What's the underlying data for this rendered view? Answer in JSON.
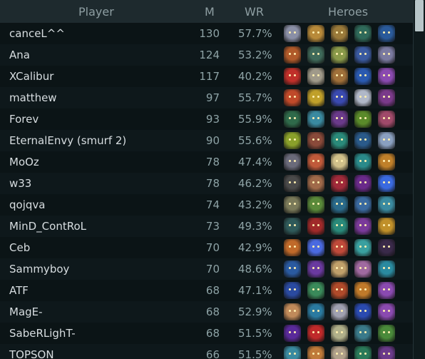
{
  "header": {
    "player": "Player",
    "m": "M",
    "wr": "WR",
    "heroes": "Heroes"
  },
  "rows": [
    {
      "name": "canceL^^",
      "m": "130",
      "wr": "57.7%",
      "heroes": [
        {
          "name": "hero-portrait",
          "color": "#8a8fa6"
        },
        {
          "name": "hero-portrait",
          "color": "#b88a3a"
        },
        {
          "name": "hero-portrait",
          "color": "#9a7a3a"
        },
        {
          "name": "hero-portrait",
          "color": "#2f6a5a"
        },
        {
          "name": "hero-portrait",
          "color": "#2a5a9a"
        }
      ]
    },
    {
      "name": "Ana",
      "m": "124",
      "wr": "53.2%",
      "heroes": [
        {
          "name": "hero-portrait",
          "color": "#b05a2a"
        },
        {
          "name": "hero-portrait",
          "color": "#3f6a5a"
        },
        {
          "name": "hero-portrait",
          "color": "#8a9a4a"
        },
        {
          "name": "hero-portrait",
          "color": "#3a5aa0"
        },
        {
          "name": "hero-portrait",
          "color": "#7a7aa0"
        }
      ]
    },
    {
      "name": "XCalibur",
      "m": "117",
      "wr": "40.2%",
      "heroes": [
        {
          "name": "hero-portrait",
          "color": "#c0302a"
        },
        {
          "name": "hero-portrait",
          "color": "#a09a8a"
        },
        {
          "name": "hero-portrait",
          "color": "#a0703a"
        },
        {
          "name": "hero-portrait",
          "color": "#2a5ab0"
        },
        {
          "name": "hero-portrait",
          "color": "#8a4ab0"
        }
      ]
    },
    {
      "name": "matthew",
      "m": "97",
      "wr": "55.7%",
      "heroes": [
        {
          "name": "hero-portrait",
          "color": "#c04a2a"
        },
        {
          "name": "hero-portrait",
          "color": "#c0a02a"
        },
        {
          "name": "hero-portrait",
          "color": "#3a4ab0"
        },
        {
          "name": "hero-portrait",
          "color": "#b0b8c8"
        },
        {
          "name": "hero-portrait",
          "color": "#7a3a8a"
        }
      ]
    },
    {
      "name": "Forev",
      "m": "93",
      "wr": "55.9%",
      "heroes": [
        {
          "name": "hero-portrait",
          "color": "#2f6a4a"
        },
        {
          "name": "hero-portrait",
          "color": "#3a8aa0"
        },
        {
          "name": "hero-portrait",
          "color": "#6a3a8a"
        },
        {
          "name": "hero-portrait",
          "color": "#5a8a2a"
        },
        {
          "name": "hero-portrait",
          "color": "#a04a6a"
        }
      ]
    },
    {
      "name": "EternalEnvy (smurf 2)",
      "m": "90",
      "wr": "55.6%",
      "heroes": [
        {
          "name": "hero-portrait",
          "color": "#8aa02a"
        },
        {
          "name": "hero-portrait",
          "color": "#8a4a3a"
        },
        {
          "name": "hero-portrait",
          "color": "#2a8a7a"
        },
        {
          "name": "hero-portrait",
          "color": "#2a5a8a"
        },
        {
          "name": "hero-portrait",
          "color": "#8aa0c0"
        }
      ]
    },
    {
      "name": "MoOz",
      "m": "78",
      "wr": "47.4%",
      "heroes": [
        {
          "name": "hero-portrait",
          "color": "#6a6a7a"
        },
        {
          "name": "hero-portrait",
          "color": "#c05a3a"
        },
        {
          "name": "hero-portrait",
          "color": "#d0c08a"
        },
        {
          "name": "hero-portrait",
          "color": "#2a8a8a"
        },
        {
          "name": "hero-portrait",
          "color": "#c0802a"
        }
      ]
    },
    {
      "name": "w33",
      "m": "78",
      "wr": "46.2%",
      "heroes": [
        {
          "name": "hero-portrait",
          "color": "#4a4a4a"
        },
        {
          "name": "hero-portrait",
          "color": "#a06a4a"
        },
        {
          "name": "hero-portrait",
          "color": "#a02a3a"
        },
        {
          "name": "hero-portrait",
          "color": "#6a2a8a"
        },
        {
          "name": "hero-portrait",
          "color": "#3a6ae0"
        }
      ]
    },
    {
      "name": "qojqva",
      "m": "74",
      "wr": "43.2%",
      "heroes": [
        {
          "name": "hero-portrait",
          "color": "#7a7a5a"
        },
        {
          "name": "hero-portrait",
          "color": "#5a8a3a"
        },
        {
          "name": "hero-portrait",
          "color": "#2a6a8a"
        },
        {
          "name": "hero-portrait",
          "color": "#3a6aa0"
        },
        {
          "name": "hero-portrait",
          "color": "#3a8aa0"
        }
      ]
    },
    {
      "name": "MinD_ContRoL",
      "m": "73",
      "wr": "49.3%",
      "heroes": [
        {
          "name": "hero-portrait",
          "color": "#2f5a5a"
        },
        {
          "name": "hero-portrait",
          "color": "#a02a2a"
        },
        {
          "name": "hero-portrait",
          "color": "#2a8a7a"
        },
        {
          "name": "hero-portrait",
          "color": "#7a3a9a"
        },
        {
          "name": "hero-portrait",
          "color": "#c0902a"
        }
      ]
    },
    {
      "name": "Ceb",
      "m": "70",
      "wr": "42.9%",
      "heroes": [
        {
          "name": "hero-portrait",
          "color": "#c06a2a"
        },
        {
          "name": "hero-portrait",
          "color": "#4a6ae0"
        },
        {
          "name": "hero-portrait",
          "color": "#c04a3a"
        },
        {
          "name": "hero-portrait",
          "color": "#3aa0a0"
        },
        {
          "name": "hero-portrait",
          "color": "#3a2a4a"
        }
      ]
    },
    {
      "name": "Sammyboy",
      "m": "70",
      "wr": "48.6%",
      "heroes": [
        {
          "name": "hero-portrait",
          "color": "#2a5aa0"
        },
        {
          "name": "hero-portrait",
          "color": "#6a3aa0"
        },
        {
          "name": "hero-portrait",
          "color": "#c0a06a"
        },
        {
          "name": "hero-portrait",
          "color": "#a06aa0"
        },
        {
          "name": "hero-portrait",
          "color": "#2a8aa0"
        }
      ]
    },
    {
      "name": "ATF",
      "m": "68",
      "wr": "47.1%",
      "heroes": [
        {
          "name": "hero-portrait",
          "color": "#2a4aa0"
        },
        {
          "name": "hero-portrait",
          "color": "#3a8a5a"
        },
        {
          "name": "hero-portrait",
          "color": "#b04a2a"
        },
        {
          "name": "hero-portrait",
          "color": "#c07a2a"
        },
        {
          "name": "hero-portrait",
          "color": "#8a4ab0"
        }
      ]
    },
    {
      "name": "MagE-",
      "m": "68",
      "wr": "52.9%",
      "heroes": [
        {
          "name": "hero-portrait",
          "color": "#c08a5a"
        },
        {
          "name": "hero-portrait",
          "color": "#2a7aa0"
        },
        {
          "name": "hero-portrait",
          "color": "#a0a0b0"
        },
        {
          "name": "hero-portrait",
          "color": "#2a4ab0"
        },
        {
          "name": "hero-portrait",
          "color": "#8a4ab0"
        }
      ]
    },
    {
      "name": "SabeRLighT-",
      "m": "68",
      "wr": "51.5%",
      "heroes": [
        {
          "name": "hero-portrait",
          "color": "#5a2a9a"
        },
        {
          "name": "hero-portrait",
          "color": "#c02a2a"
        },
        {
          "name": "hero-portrait",
          "color": "#b0b08a"
        },
        {
          "name": "hero-portrait",
          "color": "#3a7a8a"
        },
        {
          "name": "hero-portrait",
          "color": "#4a8a3a"
        }
      ]
    },
    {
      "name": "TOPSON",
      "m": "66",
      "wr": "51.5%",
      "heroes": [
        {
          "name": "hero-portrait",
          "color": "#3a8aa0"
        },
        {
          "name": "hero-portrait",
          "color": "#c07a3a"
        },
        {
          "name": "hero-portrait",
          "color": "#b0a08a"
        },
        {
          "name": "hero-portrait",
          "color": "#2a7a5a"
        },
        {
          "name": "hero-portrait",
          "color": "#6a3a8a"
        }
      ]
    }
  ]
}
